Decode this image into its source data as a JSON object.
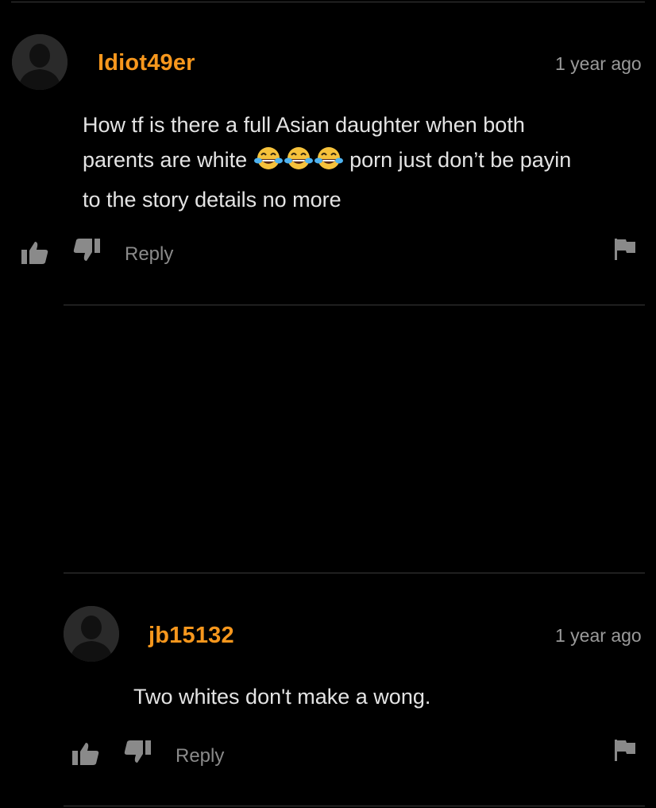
{
  "comments": [
    {
      "username": "Idiot49er",
      "time": "1 year ago",
      "text_line1": "How tf is there a full Asian daughter when both",
      "text_line2_before": "parents are white ",
      "text_line2_after": " porn just don’t be payin",
      "text_line3": "to the story details no more",
      "emojis": [
        "face-with-tears-of-joy",
        "face-with-tears-of-joy",
        "face-with-tears-of-joy"
      ],
      "reply_label": "Reply"
    },
    {
      "username": "jb15132",
      "time": "1 year ago",
      "text": "Two whites don't make a wong.",
      "reply_label": "Reply"
    }
  ],
  "colors": {
    "background": "#000000",
    "username": "#f7971d",
    "text": "#e4e4e4",
    "muted": "#8a8a8a",
    "divider": "#3a3a3a"
  }
}
